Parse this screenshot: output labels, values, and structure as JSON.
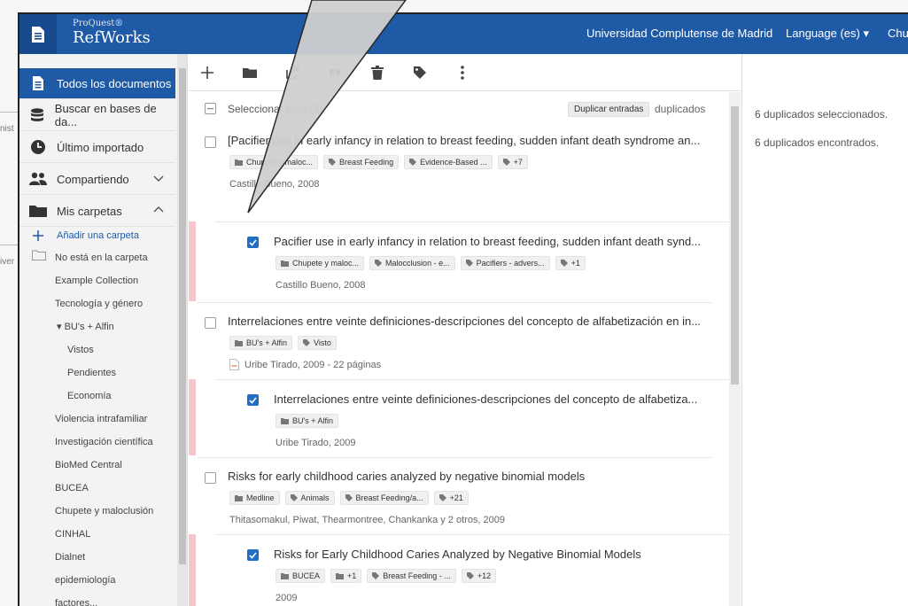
{
  "header": {
    "brand_small": "ProQuest®",
    "brand_big": "RefWorks",
    "institution": "Universidad Complutense de Madrid",
    "language": "Language (es) ▾",
    "user": "Chu"
  },
  "background": {
    "frag1": "nist",
    "frag2": "iver"
  },
  "sidebar": {
    "nav": [
      {
        "label": "Todos los documentos",
        "icon": "document-icon"
      },
      {
        "label": "Buscar en bases de da...",
        "icon": "database-icon"
      },
      {
        "label": "Último importado",
        "icon": "clock-icon"
      },
      {
        "label": "Compartiendo",
        "icon": "people-icon"
      },
      {
        "label": "Mis carpetas",
        "icon": "folder-icon"
      }
    ],
    "add_folder": "Añadir una carpeta",
    "folders": [
      "No está en la carpeta",
      "Example Collection",
      "Tecnología y género",
      "▾ BU's + Alfin",
      "Vistos",
      "Pendientes",
      "Economía",
      "Violencia intrafamiliar",
      "Investigación científica",
      "BioMed Central",
      "BUCEA",
      "Chupete y maloclusión",
      "CINHAL",
      "Dialnet",
      "epidemiología",
      "factores..."
    ]
  },
  "list": {
    "select_label": "Seleccionar todo (6)",
    "dup_button": "Duplicar entradas",
    "dup_label": "duplicados",
    "records": [
      {
        "title": "[Pacifier use in early infancy in relation to breast feeding, sudden infant death syndrome an...",
        "tags": [
          "Chupete y maloc...",
          "Breast Feeding",
          "Evidence-Based ...",
          "+7"
        ],
        "meta": "Castillo Bueno, 2008",
        "checked": false
      },
      {
        "title": "Pacifier use in early infancy in relation to breast feeding, sudden infant death synd...",
        "tags": [
          "Chupete y maloc...",
          "Malocclusion - e...",
          "Pacifiers - advers...",
          "+1"
        ],
        "meta": "Castillo Bueno, 2008",
        "checked": true
      },
      {
        "title": "Interrelaciones entre veinte definiciones-descripciones del concepto de alfabetización en in...",
        "tags": [
          "BU's + Alfin",
          "Visto"
        ],
        "meta": "Uribe Tirado, 2009 - 22 páginas",
        "checked": false
      },
      {
        "title": "Interrelaciones entre veinte definiciones-descripciones del concepto de alfabetiza...",
        "tags": [
          "BU's + Alfin"
        ],
        "meta": "Uribe Tirado, 2009",
        "checked": true
      },
      {
        "title": "Risks for early childhood caries analyzed by negative binomial models",
        "tags": [
          "Medline",
          "Animals",
          "Breast Feeding/a...",
          "+21"
        ],
        "meta": "Thitasomakul, Piwat, Thearmontree, Chankanka y 2 otros, 2009",
        "checked": false
      },
      {
        "title": "Risks for Early Childhood Caries Analyzed by Negative Binomial Models",
        "tags": [
          "BUCEA",
          "+1",
          "Breast Feeding - ...",
          "+12"
        ],
        "meta": "2009",
        "checked": true
      }
    ]
  },
  "right_panel": {
    "selected": "6 duplicados seleccionados.",
    "found": "6 duplicados encontrados."
  },
  "colors": {
    "brand": "#1f5aa6",
    "checkbox": "#1f6fc4",
    "dup_marker": "#f5c6cb"
  }
}
